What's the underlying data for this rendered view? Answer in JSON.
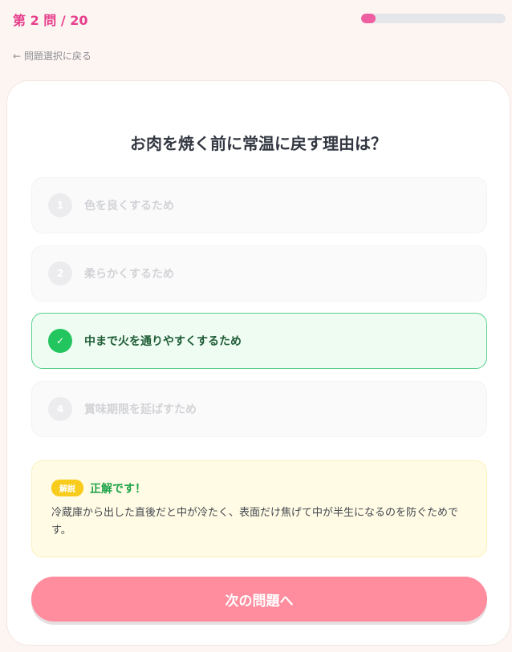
{
  "header": {
    "counter": "第 2 問 / 20",
    "progress": 0.1
  },
  "back_link": "← 問題選択に戻る",
  "question": "お肉を焼く前に常温に戻す理由は？",
  "options": [
    {
      "number": "1",
      "label": "色を良くするため",
      "state": "disabled"
    },
    {
      "number": "2",
      "label": "柔らかくするため",
      "state": "disabled"
    },
    {
      "number": "✓",
      "label": "中まで火を通りやすくするため",
      "state": "correct"
    },
    {
      "number": "4",
      "label": "賞味期限を延ばすため",
      "state": "disabled"
    }
  ],
  "explanation": {
    "badge": "解説",
    "verdict": "正解です！",
    "text": "冷蔵庫から出した直後だと中が冷たく、表面だけ焦げて中が半生になるのを防ぐためです。"
  },
  "next_button": "次の問題へ",
  "colors": {
    "accent_pink": "#e63e8c",
    "progress_fill": "#ee5fa2",
    "correct_green": "#22c55e",
    "button_pink": "#ff8d9e",
    "badge_yellow": "#f8cc1c"
  }
}
